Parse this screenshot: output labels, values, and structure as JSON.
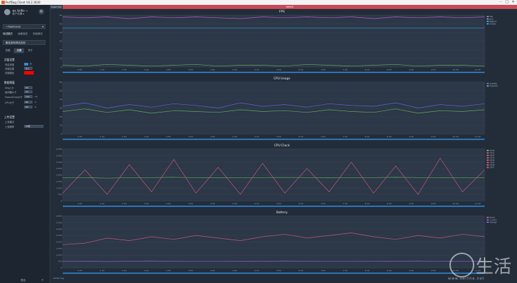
{
  "window": {
    "title": "PerfDog Client V4.2.3030",
    "controls": [
      "–",
      "□",
      "✕"
    ]
  },
  "sidebar": {
    "user": {
      "name": "ws Selfie ☆",
      "copy_label": "账户设置 ▸"
    },
    "settings_icon": "gear-icon",
    "device": {
      "label": "• PAUES416",
      "dropdown": "▾"
    },
    "modes": [
      {
        "label": "测试模式",
        "selected": true
      },
      {
        "label": "远程测试",
        "selected": false
      },
      {
        "label": "本地测试",
        "selected": false
      }
    ],
    "app_select": {
      "label": "最佳游戏测试应用"
    },
    "tabs": [
      {
        "label": "性能",
        "selected": false
      },
      {
        "label": "设置",
        "selected": true
      },
      {
        "label": "关于",
        "selected": false
      }
    ],
    "display_section": {
      "title": "浮窗设置",
      "rows": [
        {
          "label": "开启浮窗",
          "value": "开"
        },
        {
          "label": "浮窗位置",
          "value": "左上"
        },
        {
          "label": "浮窗颜色",
          "value": ""
        }
      ]
    },
    "threshold_section": {
      "title": "数据阈值",
      "rows": [
        {
          "label": "FPS小于",
          "value": "30"
        },
        {
          "label": "帧间隔大于",
          "value": "33"
        },
        {
          "label": "FrameTime大于",
          "value": "100",
          "unit": "ms"
        },
        {
          "label": "CPU大于",
          "value": "80",
          "unit": "%"
        },
        {
          "label": "",
          "value": "80",
          "unit": "%"
        }
      ]
    },
    "upload_section": {
      "title": "上传设置",
      "rows": [
        {
          "label": "上传模式",
          "value": ""
        },
        {
          "label": "上传频率",
          "value": "30秒"
        }
      ]
    },
    "bottom_button": "退出",
    "collapse_icon": "«"
  },
  "main": {
    "tab_small": "Case1 Set",
    "tab_active": "label1",
    "footer_text": "◂ 0:00 Log"
  },
  "chart_data": [
    {
      "type": "line",
      "title": "FPS",
      "ylim": [
        0,
        60
      ],
      "y_ticks": [
        "60",
        "50",
        "40",
        "30",
        "20",
        "10",
        "0"
      ],
      "x_ticks": [
        "0:35",
        "1:10",
        "1:45",
        "2:20",
        "2:55",
        "3:30",
        "4:05",
        "4:40",
        "5:15",
        "5:50",
        "6:25",
        "7:00",
        "7:35",
        "8:10",
        "8:45",
        "9:20",
        "9:55",
        "10:30",
        "11:05"
      ],
      "series": [
        {
          "name": "FPS",
          "color": "#c255d6",
          "values": [
            58,
            57,
            58,
            56,
            58,
            57,
            58,
            57,
            56,
            58,
            57,
            58,
            57,
            58,
            56,
            58,
            57,
            58,
            57,
            58
          ]
        },
        {
          "name": "Jank",
          "color": "#5fae5f",
          "values": [
            2,
            1,
            3,
            2,
            1,
            2,
            3,
            1,
            2,
            2,
            1,
            3,
            2,
            1,
            2,
            3,
            1,
            2,
            2,
            1
          ]
        },
        {
          "name": "Stutter",
          "color": "#3b9be0",
          "values": [
            45,
            45,
            45,
            45,
            45,
            45,
            45,
            45,
            45,
            45,
            45,
            45,
            45,
            45,
            45,
            45,
            45,
            45,
            45,
            45
          ]
        }
      ],
      "legend": [
        "FPS",
        "Jank",
        "BigJank",
        "Stutter"
      ]
    },
    {
      "type": "line",
      "title": "CPU Usage",
      "ylim": [
        0,
        60
      ],
      "y_ticks": [
        "60",
        "50",
        "40",
        "30",
        "20",
        "10",
        "0"
      ],
      "x_ticks": [
        "0:35",
        "1:10",
        "1:45",
        "2:20",
        "2:55",
        "3:30",
        "4:05",
        "4:40",
        "5:15",
        "5:50",
        "6:25",
        "7:00",
        "7:35",
        "8:10",
        "8:45",
        "9:20",
        "9:55",
        "10:30",
        "11:05"
      ],
      "series": [
        {
          "name": "AppCPU",
          "color": "#5b67d8",
          "values": [
            32,
            36,
            30,
            34,
            31,
            35,
            33,
            30,
            36,
            32,
            34,
            31,
            35,
            33,
            32,
            36,
            30,
            34,
            32,
            35
          ]
        },
        {
          "name": "TotalCPU",
          "color": "#5fae5f",
          "values": [
            26,
            29,
            25,
            28,
            24,
            27,
            26,
            25,
            28,
            26,
            27,
            25,
            28,
            26,
            25,
            29,
            24,
            27,
            26,
            28
          ]
        }
      ],
      "legend": [
        "AppCPU",
        "TotalCPU"
      ]
    },
    {
      "type": "line",
      "title": "CPU Clock",
      "ylim": [
        0,
        4000
      ],
      "y_ticks": [
        "4,000",
        "3,500",
        "3,000",
        "2,500",
        "2,000",
        "1,500",
        "1,000",
        "500",
        "0"
      ],
      "x_ticks": [
        "0:35",
        "1:10",
        "1:45",
        "2:20",
        "2:55",
        "3:30",
        "4:05",
        "4:40",
        "5:15",
        "5:50",
        "6:25",
        "7:00",
        "7:35",
        "8:10",
        "8:45",
        "9:20",
        "9:55",
        "10:30",
        "11:05"
      ],
      "series": [
        {
          "name": "CPU0",
          "color": "#5fae5f",
          "values": [
            1800,
            1800,
            1750,
            1800,
            1800,
            1820,
            1800,
            1780,
            1800,
            1800,
            1810,
            1800,
            1790,
            1800,
            1800,
            1820,
            1800,
            1780,
            1800,
            1800
          ]
        },
        {
          "name": "CPU7",
          "color": "#c05a7a",
          "values": [
            600,
            2400,
            500,
            2800,
            700,
            3200,
            600,
            2600,
            500,
            2900,
            600,
            2500,
            700,
            3000,
            600,
            2700,
            500,
            3300,
            700,
            2400
          ]
        }
      ],
      "legend": [
        "CPU0",
        "CPU1",
        "CPU2",
        "CPU3",
        "CPU4",
        "CPU5",
        "CPU6",
        "CPU7"
      ]
    },
    {
      "type": "line",
      "title": "Battery",
      "ylim": [
        0,
        4000
      ],
      "y_ticks": [
        "4,000",
        "3,500",
        "3,000",
        "2,500",
        "2,000",
        "1,500",
        "1,000",
        "500",
        "0"
      ],
      "x_ticks": [
        "0:35",
        "1:10",
        "1:45",
        "2:20",
        "2:55",
        "3:30",
        "4:05",
        "4:40",
        "5:15",
        "5:50",
        "6:25",
        "7:00",
        "7:35",
        "8:10",
        "8:45",
        "9:20",
        "9:55",
        "10:30",
        "11:05"
      ],
      "series": [
        {
          "name": "Power",
          "color": "#c05a7a",
          "values": [
            1800,
            1900,
            2300,
            2100,
            2400,
            2200,
            2500,
            2300,
            2100,
            2400,
            2600,
            2300,
            2500,
            2700,
            2400,
            2200,
            2500,
            2300,
            2600,
            2400
          ]
        },
        {
          "name": "Current",
          "color": "#8a5cc7",
          "values": [
            500,
            520,
            480,
            510,
            530,
            500,
            490,
            520,
            510,
            500,
            530,
            510,
            490,
            520,
            500,
            510,
            530,
            500,
            520,
            510
          ]
        }
      ],
      "legend": [
        "Power",
        "Current",
        "Voltage"
      ]
    }
  ],
  "watermark": {
    "text": "生活",
    "url": "www.sellite.net"
  }
}
